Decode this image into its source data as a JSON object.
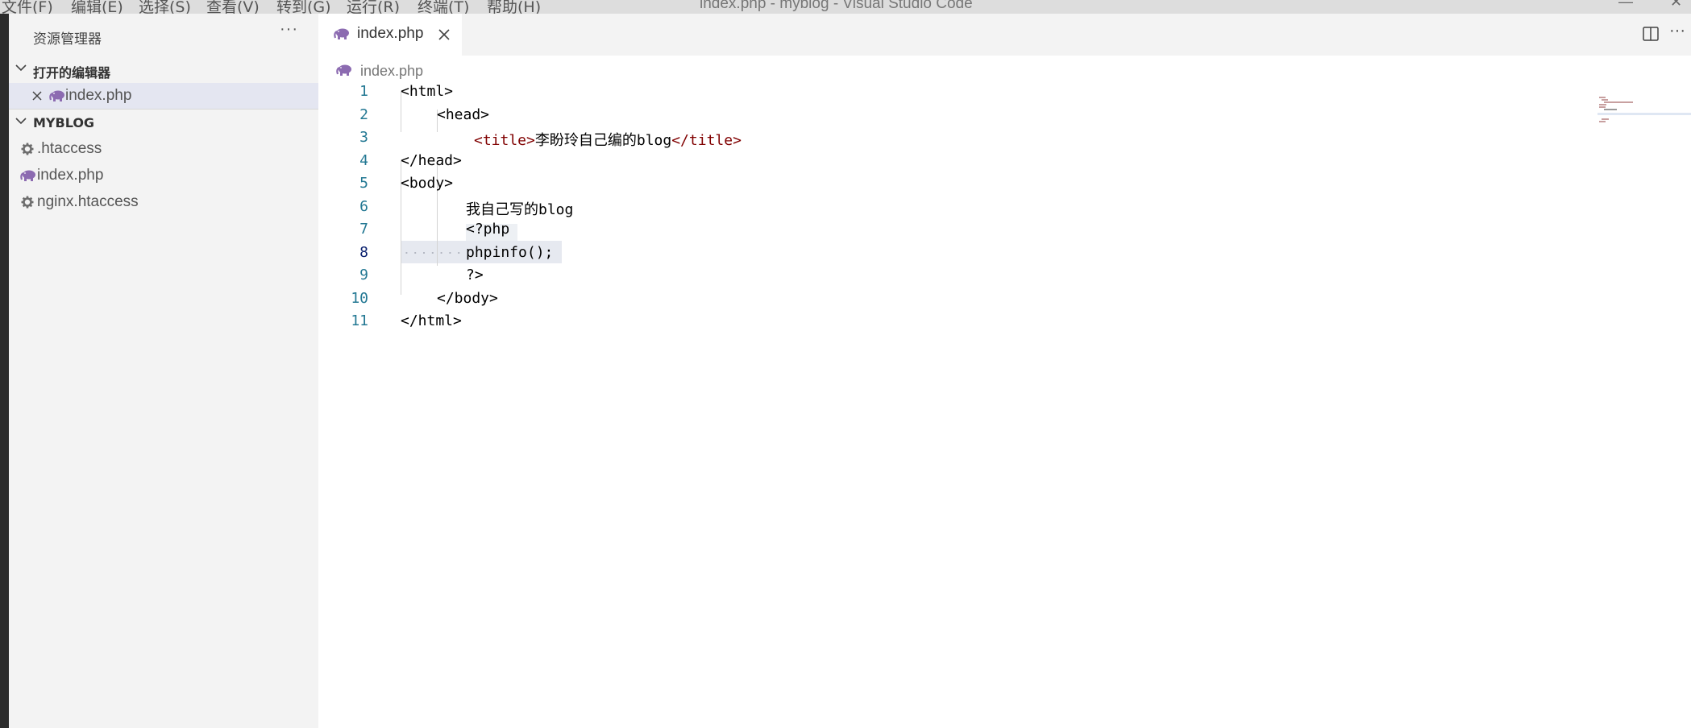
{
  "window": {
    "title": "index.php - myblog - Visual Studio Code",
    "menu": [
      "文件(F)",
      "编辑(E)",
      "选择(S)",
      "查看(V)",
      "转到(G)",
      "运行(R)",
      "终端(T)",
      "帮助(H)"
    ]
  },
  "sidebar": {
    "title": "资源管理器",
    "more_label": "···",
    "open_editors": {
      "label": "打开的编辑器",
      "items": [
        {
          "label": "index.php"
        }
      ]
    },
    "project": {
      "label": "MYBLOG",
      "files": [
        {
          "label": ".htaccess",
          "icon": "gear-icon"
        },
        {
          "label": "index.php",
          "icon": "php-elephant-icon"
        },
        {
          "label": "nginx.htaccess",
          "icon": "gear-icon"
        }
      ]
    }
  },
  "editor": {
    "tab": {
      "label": "index.php"
    },
    "breadcrumb": {
      "label": "index.php"
    },
    "more_label": "···",
    "lines": [
      {
        "num": "1",
        "text": "<html>"
      },
      {
        "num": "2",
        "text": "<head>"
      },
      {
        "num": "3",
        "open": "<title>",
        "content": "李盼玲自己编的blog",
        "close": "</title>"
      },
      {
        "num": "4",
        "text": "</head>"
      },
      {
        "num": "5",
        "text": "<body>"
      },
      {
        "num": "6",
        "text": "我自己写的blog"
      },
      {
        "num": "7",
        "text": "<?php"
      },
      {
        "num": "8",
        "text": "phpinfo();"
      },
      {
        "num": "9",
        "text": "?>"
      },
      {
        "num": "10",
        "text": "</body>"
      },
      {
        "num": "11",
        "text": "</html>"
      }
    ]
  },
  "colors": {
    "tag": "#800000",
    "line_number": "#237893",
    "active_line_number": "#0b216f",
    "php_icon": "#8c6bb1",
    "sidebar_bg": "#f3f3f3",
    "selected_bg": "#e4e6f1"
  }
}
